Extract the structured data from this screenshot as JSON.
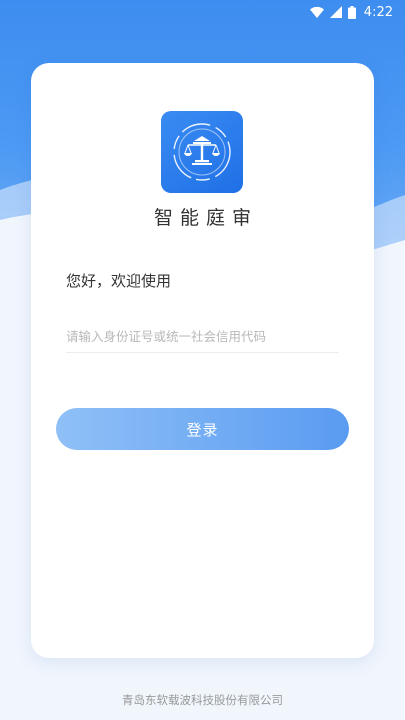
{
  "status_bar": {
    "time": "4:22"
  },
  "app": {
    "name": "智能庭审",
    "logo_icon": "scales-of-justice-icon"
  },
  "login": {
    "greeting": "您好，欢迎使用",
    "id_placeholder": "请输入身份证号或统一社会信用代码",
    "id_value": "",
    "submit_label": "登录"
  },
  "footer": {
    "company": "青岛东软载波科技股份有限公司"
  },
  "colors": {
    "primary": "#3d8df0",
    "button_start": "#8fc0f7",
    "button_end": "#5a9bf1",
    "text": "#333333",
    "placeholder": "#b8b8b8"
  }
}
